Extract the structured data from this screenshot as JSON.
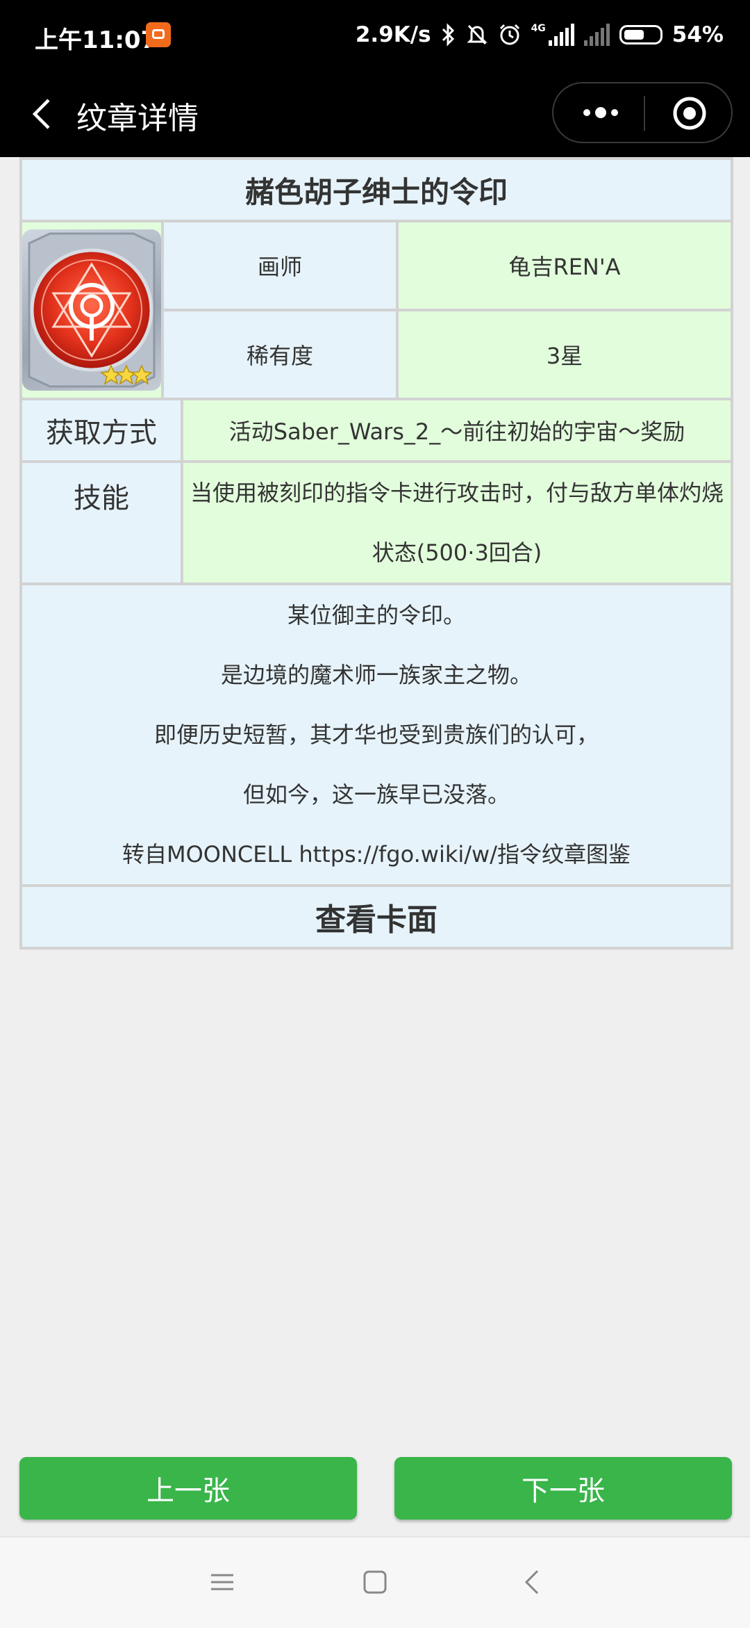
{
  "status_bar": {
    "time": "上午11:07",
    "net_speed": "2.9K/s",
    "network_type": "4G",
    "battery": "54%"
  },
  "nav": {
    "title": "纹章详情"
  },
  "card": {
    "name": "赭色胡子绅士的令印",
    "illustrator_label": "画师",
    "illustrator": "龟吉REN'A",
    "rarity_label": "稀有度",
    "rarity": "3星",
    "acquire_label": "获取方式",
    "acquire": "活动Saber_Wars_2_～前往初始的宇宙～奖励",
    "skill_label": "技能",
    "skill_line1": "当使用被刻印的指令卡进行攻击时，付与敌方单体灼烧",
    "skill_line2": "状态(500·3回合)",
    "description": [
      "某位御主的令印。",
      "是边境的魔术师一族家主之物。",
      "即便历史短暂，其才华也受到贵族们的认可，",
      "但如今，这一族早已没落。",
      "转自MOONCELL https://fgo.wiki/w/指令纹章图鉴"
    ],
    "view_face": "查看卡面"
  },
  "buttons": {
    "prev": "上一张",
    "next": "下一张"
  },
  "colors": {
    "header_blue": "#e6f3fa",
    "value_green": "#e2fddc",
    "button_green": "#39b54a"
  }
}
